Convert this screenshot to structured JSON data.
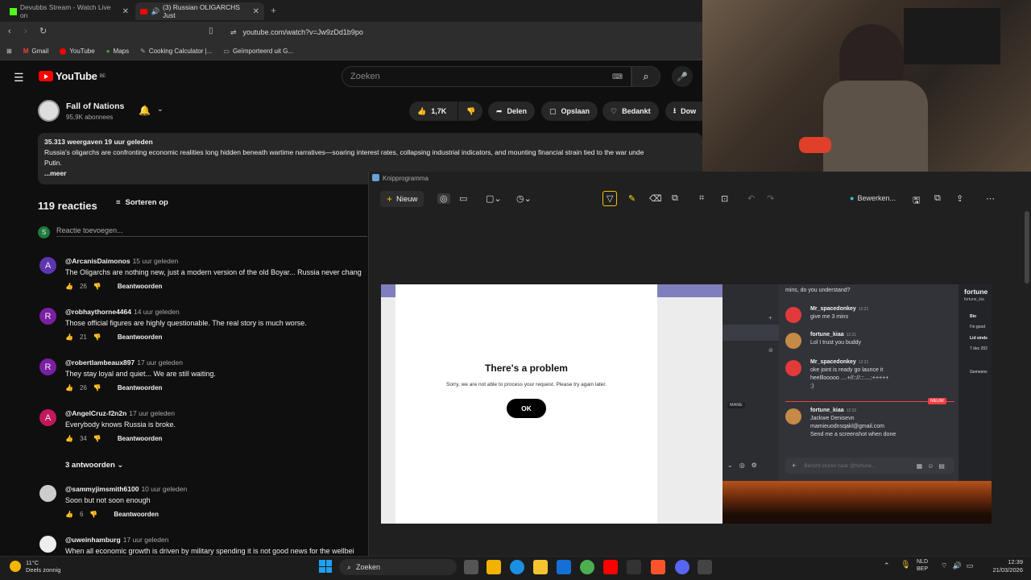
{
  "tabs": [
    {
      "label": "Devubbs Stream - Watch Live on",
      "active": false
    },
    {
      "label": "(3) Russian OLIGARCHS Just",
      "active": true
    }
  ],
  "address": {
    "url": "youtube.com/watch?v=Jw9zDd1b9po"
  },
  "bookmarks": [
    "Gmail",
    "YouTube",
    "Maps",
    "Cooking Calculator |...",
    "Geïmporteerd uit G..."
  ],
  "yt": {
    "logo_text": "YouTube",
    "region": "BE",
    "search_placeholder": "Zoeken",
    "channel_name": "Fall of Nations",
    "channel_subs": "95,9K abonnees",
    "like_count": "1,7K",
    "share_label": "Delen",
    "save_label": "Opslaan",
    "thanks_label": "Bedankt",
    "download_label": "Dow",
    "views_time": "35.313 weergaven  19 uur geleden",
    "description": "Russia's oligarchs are confronting economic realities long hidden beneath wartime narratives—soaring interest rates, collapsing industrial indicators, and mounting financial strain tied to the war unde",
    "description_line2": "Putin.",
    "more_label": "...meer",
    "comments_count": "119 reacties",
    "sort_label": "Sorteren op",
    "add_comment_avatar": "S",
    "add_comment_placeholder": "Reactie toevoegen...",
    "reply_label": "Beantwoorden",
    "replies_toggle": "3 antwoorden"
  },
  "comments": [
    {
      "initial": "A",
      "color": "#5e35b1",
      "author": "@ArcanisDaimonos",
      "time": "15 uur geleden",
      "text": "The Oligarchs are nothing new, just a modern version of the old Boyar... Russia never chang",
      "likes": "26"
    },
    {
      "initial": "R",
      "color": "#7b1fa2",
      "author": "@robhaythorne4464",
      "time": "14 uur geleden",
      "text": "Those official figures are highly questionable. The real story is much worse.",
      "likes": "21"
    },
    {
      "initial": "R",
      "color": "#7b1fa2",
      "author": "@robertlambeaux897",
      "time": "17 uur geleden",
      "text": "They stay loyal and quiet... We are still waiting.",
      "likes": "26"
    },
    {
      "initial": "A",
      "color": "#c2185b",
      "author": "@AngelCruz-f2n2n",
      "time": "17 uur geleden",
      "text": "Everybody knows Russia is broke.",
      "likes": "34"
    },
    {
      "initial": "",
      "color": "#cccccc",
      "author": "@sammyjimsmith6100",
      "time": "10 uur geleden",
      "text": "Soon but not soon enough",
      "likes": "6"
    },
    {
      "initial": "",
      "color": "#eeeeee",
      "author": "@uweinhamburg",
      "time": "17 uur geleden",
      "text": "When all economic growth is driven by military spending it is not good news for the wellbei",
      "likes": ""
    }
  ],
  "snip": {
    "title": "Knipprogramma",
    "new_label": "Nieuw",
    "edit_label": "Bewerken..."
  },
  "capture": {
    "problem_title": "There's a problem",
    "problem_msg": "Sorry, we are not able to process your request. Please try again later.",
    "ok_label": "OK",
    "discord_top": "mins, do you understand?",
    "discord_messages": [
      {
        "name": "Mr_spacedonkey",
        "time": "12:21",
        "lines": [
          "give me 3 mins"
        ],
        "color": "#e23a3a"
      },
      {
        "name": "fortune_kiaa",
        "time": "12:21",
        "lines": [
          "Lol I trust you buddy"
        ],
        "color": "#c58a45"
      },
      {
        "name": "Mr_spacedonkey",
        "time": "12:21",
        "lines": [
          "oke joint is ready go launce it",
          "heelllooooo ....+//:://:::....:+++++",
          ";)"
        ],
        "color": "#e23a3a"
      },
      {
        "name": "fortune_kiaa",
        "time": "12:32",
        "lines": [
          "Jackwe Denisevn",
          "mamieuodnsqakl@gmail.com",
          "Send me a screenshot when done"
        ],
        "color": "#c58a45"
      }
    ],
    "discord_input": "Bericht sturen naar @fortune...",
    "discord_profile_name": "fortune",
    "discord_profile_handle": "fortune_kia",
    "discord_bio_label": "Bio",
    "discord_bio_text": "I'm good",
    "discord_member_label": "Lid sinds",
    "discord_member_date": "7 dec 202",
    "discord_shared_label": "Gemeens",
    "discord_new_label": "NIEUW",
    "discord_sidebar_tag": "MANE"
  },
  "taskbar": {
    "temp": "11°C",
    "weather": "Deels zonnig",
    "search_label": "Zoeken",
    "lang_1": "NLD",
    "lang_2": "BEP",
    "time": "12:39",
    "date": "21/03/2026"
  }
}
